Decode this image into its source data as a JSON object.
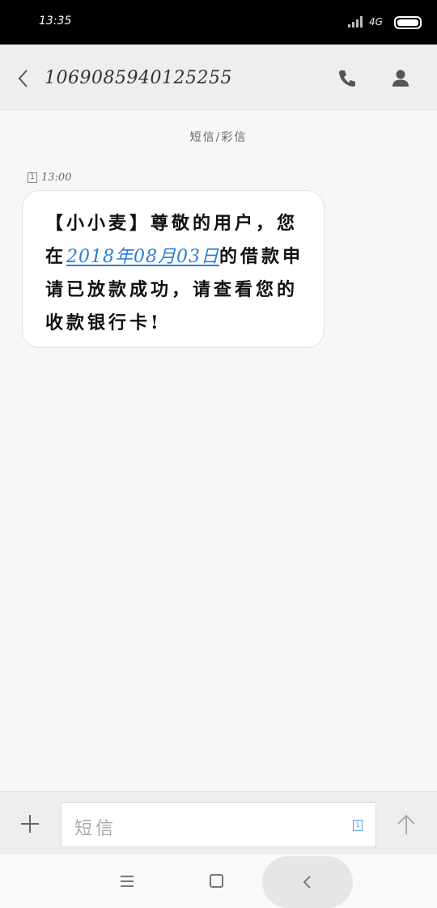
{
  "status_bar": {
    "time": "13:35",
    "network": "4G"
  },
  "header": {
    "title": "1069085940125255",
    "icons": [
      "back-icon",
      "phone-icon",
      "contact-icon"
    ]
  },
  "conversation": {
    "type_label": "短信/彩信",
    "messages": [
      {
        "sim": "1",
        "time": "13:00",
        "text_before": "【小小麦】尊敬的用户，您在",
        "link_text": "2018年08月03日",
        "text_after": "的借款申请已放款成功，请查看您的收款银行卡!"
      }
    ]
  },
  "composer": {
    "placeholder": "短信",
    "sim": "1",
    "icons": [
      "plus-icon",
      "send-arrow-icon"
    ]
  },
  "nav": {
    "icons": [
      "menu-icon",
      "home-icon",
      "back-icon"
    ]
  },
  "colors": {
    "link": "#2b7dd3",
    "header_bg": "#eeeeee",
    "page_bg": "#f7f7f7"
  }
}
